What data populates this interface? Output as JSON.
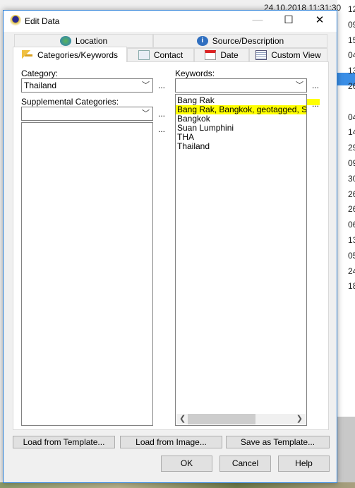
{
  "background": {
    "date_text": "24.10.2018 11:31:30",
    "right_column": [
      "12",
      "09",
      "15",
      "04",
      "13",
      "26",
      "20",
      "04",
      "14",
      "29",
      "09",
      "30",
      "26",
      "26",
      "06",
      "13",
      "05",
      "24",
      "18"
    ]
  },
  "dialog": {
    "title": "Edit Data",
    "minimize": "—",
    "maximize": "☐",
    "close": "✕"
  },
  "tabs": {
    "top": [
      {
        "label": "Location",
        "icon": "globe-icon"
      },
      {
        "label": "Source/Description",
        "icon": "info-icon"
      }
    ],
    "bottom": [
      {
        "label": "Categories/Keywords",
        "icon": "key-icon",
        "active": true
      },
      {
        "label": "Contact",
        "icon": "contact-card-icon"
      },
      {
        "label": "Date",
        "icon": "calendar-icon"
      },
      {
        "label": "Custom View",
        "icon": "grid-icon"
      }
    ]
  },
  "form": {
    "category_label": "Category:",
    "category_value": "Thailand",
    "supplemental_label": "Supplemental Categories:",
    "supplemental_value": "",
    "keywords_label": "Keywords:",
    "keywords_value": "",
    "ellipsis": "...",
    "keywords": [
      "Bang Rak",
      "Bang Rak, Bangkok, geotagged, Suan",
      "Bangkok",
      "Suan Lumphini",
      "THA",
      "Thailand"
    ],
    "highlighted_index": 1,
    "highlight_color": "#ffff00"
  },
  "buttons": {
    "load_template": "Load from Template...",
    "load_image": "Load from Image...",
    "save_template": "Save as Template...",
    "ok": "OK",
    "cancel": "Cancel",
    "help": "Help"
  }
}
